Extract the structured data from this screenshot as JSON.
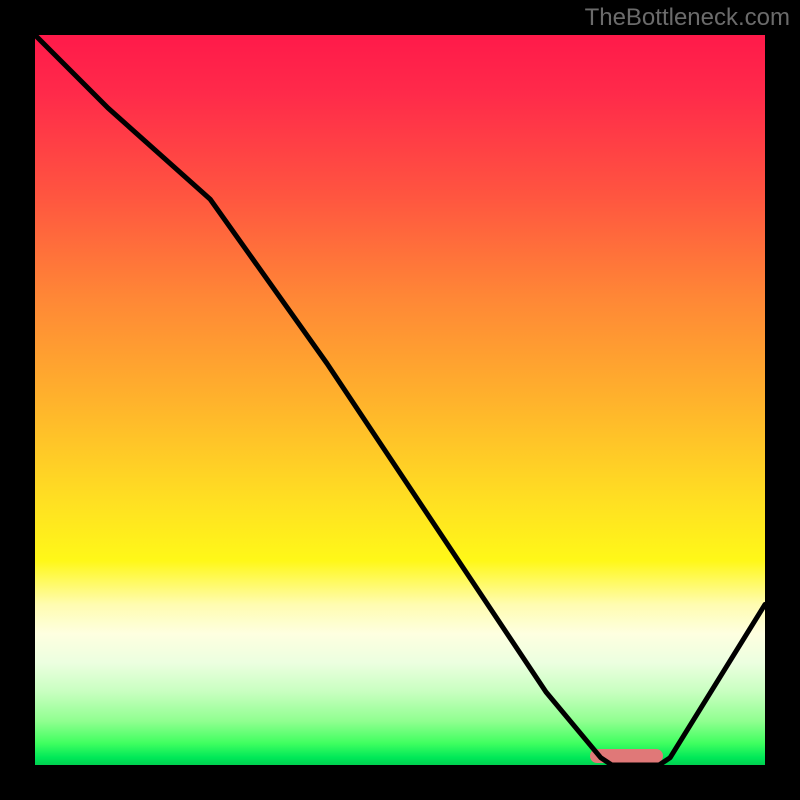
{
  "watermark": "TheBottleneck.com",
  "chart_data": {
    "type": "line",
    "title": "",
    "xlabel": "",
    "ylabel": "",
    "ylim": [
      0,
      100
    ],
    "xlim": [
      0,
      100
    ],
    "x": [
      0,
      10,
      24,
      40,
      55,
      70,
      78,
      85,
      100
    ],
    "values": [
      100,
      90,
      78,
      55,
      32,
      10,
      0,
      0,
      22
    ],
    "minimum_band": {
      "x_start": 76,
      "x_end": 86,
      "y": 0
    },
    "curve_normalized": [
      [
        0.0,
        0.0
      ],
      [
        0.1,
        0.1
      ],
      [
        0.24,
        0.225
      ],
      [
        0.4,
        0.45
      ],
      [
        0.55,
        0.675
      ],
      [
        0.7,
        0.9
      ],
      [
        0.775,
        0.99
      ],
      [
        0.79,
        1.0
      ],
      [
        0.855,
        1.0
      ],
      [
        0.87,
        0.99
      ],
      [
        1.0,
        0.78
      ]
    ]
  }
}
